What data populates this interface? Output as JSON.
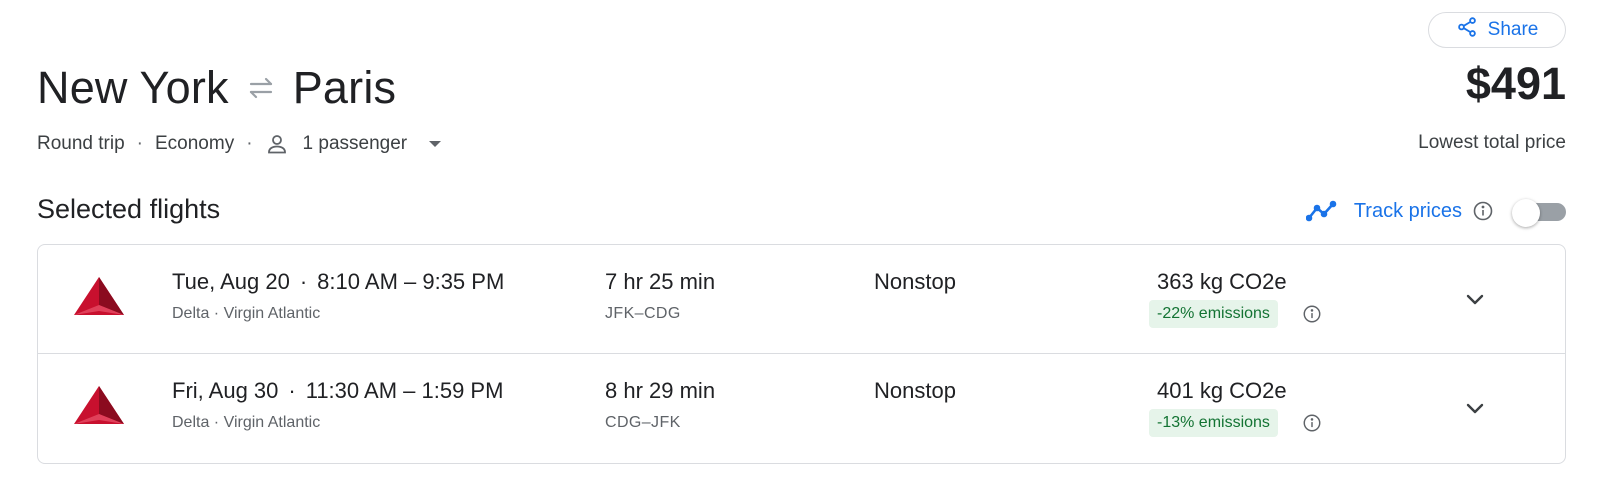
{
  "header": {
    "share_label": "Share",
    "origin": "New York",
    "destination": "Paris",
    "price": "$491",
    "price_caption": "Lowest total price"
  },
  "options": {
    "trip_type": "Round trip",
    "cabin_class": "Economy",
    "passengers": "1 passenger"
  },
  "section": {
    "title": "Selected flights",
    "track_prices_label": "Track prices",
    "track_prices_enabled": false
  },
  "flights": [
    {
      "date": "Tue, Aug 20",
      "time_range": "8:10 AM – 9:35 PM",
      "airlines": "Delta · Virgin Atlantic",
      "duration": "7 hr 25 min",
      "route": "JFK–CDG",
      "stops": "Nonstop",
      "emissions": "363 kg CO2e",
      "emissions_delta": "-22% emissions"
    },
    {
      "date": "Fri, Aug 30",
      "time_range": "11:30 AM – 1:59 PM",
      "airlines": "Delta · Virgin Atlantic",
      "duration": "8 hr 29 min",
      "route": "CDG–JFK",
      "stops": "Nonstop",
      "emissions": "401 kg CO2e",
      "emissions_delta": "-13% emissions"
    }
  ],
  "icons": {
    "share": "share-icon",
    "swap": "swap-arrows-icon",
    "person": "person-icon",
    "caret": "caret-down-icon",
    "trend": "trending-line-icon",
    "info": "info-icon",
    "airline_logo": "delta-logo-icon",
    "expand": "chevron-down-icon"
  },
  "colors": {
    "accent": "#1a73e8",
    "text_primary": "#202124",
    "text_secondary": "#5f6368",
    "emissions_badge_bg": "#e6f4ea",
    "emissions_badge_text": "#137333",
    "delta_red": "#c8102e",
    "border": "#dadce0"
  }
}
